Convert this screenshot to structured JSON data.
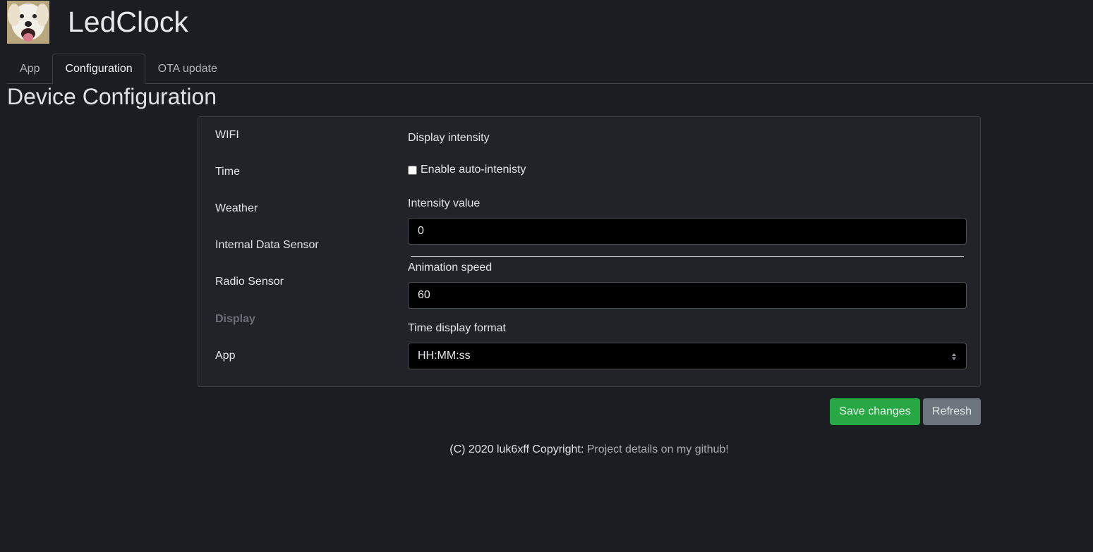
{
  "header": {
    "title": "LedClock",
    "logo_icon": "dog-photo-icon"
  },
  "tabs": [
    {
      "label": "App"
    },
    {
      "label": "Configuration",
      "active": true
    },
    {
      "label": "OTA update"
    }
  ],
  "page_title": "Device Configuration",
  "sidebar": {
    "items": [
      {
        "label": "WIFI"
      },
      {
        "label": "Time"
      },
      {
        "label": "Weather"
      },
      {
        "label": "Internal Data Sensor"
      },
      {
        "label": "Radio Sensor"
      },
      {
        "label": "Display",
        "active": true
      },
      {
        "label": "App"
      }
    ]
  },
  "display": {
    "section_title": "Display intensity",
    "auto_intensity_label": "Enable auto-intenisty",
    "auto_intensity_checked": false,
    "intensity_label": "Intensity value",
    "intensity_value": "0",
    "animation_label": "Animation speed",
    "animation_value": "60",
    "time_format_label": "Time display format",
    "time_format_value": "HH:MM:ss"
  },
  "buttons": {
    "save": "Save changes",
    "refresh": "Refresh"
  },
  "footer": {
    "text": "(C) 2020 luk6xff Copyright: ",
    "link": "Project details on my github!"
  },
  "colors": {
    "save": "#28a745",
    "refresh": "#6c757d",
    "background": "#1b1d22"
  }
}
